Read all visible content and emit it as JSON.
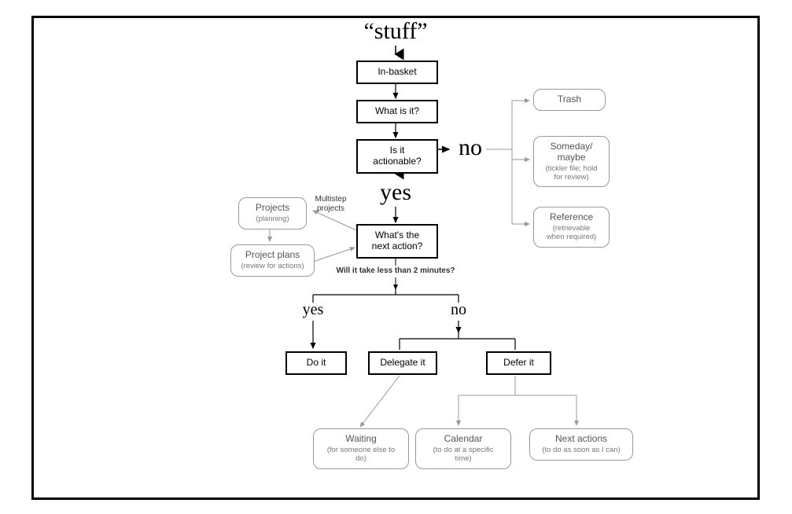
{
  "title": "“stuff”",
  "boxes": {
    "in_basket": "In-basket",
    "what_is_it": "What is it?",
    "is_actionable": "Is it actionable?",
    "next_action": "What's the\nnext action?",
    "do_it": "Do it",
    "delegate": "Delegate it",
    "defer": "Defer it"
  },
  "branches": {
    "no": "no",
    "yes": "yes",
    "yes2": "yes",
    "no2": "no"
  },
  "questions": {
    "under_two_min": "Will it take less than 2 minutes?"
  },
  "labels": {
    "multistep": "Multistep\nprojects"
  },
  "nonaction": {
    "trash": {
      "title": "Trash",
      "sub": ""
    },
    "someday": {
      "title": "Someday/\nmaybe",
      "sub": "(tickler file; hold\nfor review)"
    },
    "reference": {
      "title": "Reference",
      "sub": "(retrievable\nwhen required)"
    }
  },
  "projects": {
    "projects": {
      "title": "Projects",
      "sub": "(planning)"
    },
    "plans": {
      "title": "Project plans",
      "sub": "(review for actions)"
    }
  },
  "outcomes": {
    "waiting": {
      "title": "Waiting",
      "sub": "(for someone else to do)"
    },
    "calendar": {
      "title": "Calendar",
      "sub": "(to do at a specific time)"
    },
    "next_actions": {
      "title": "Next actions",
      "sub": "(to do as soon as I can)"
    }
  }
}
